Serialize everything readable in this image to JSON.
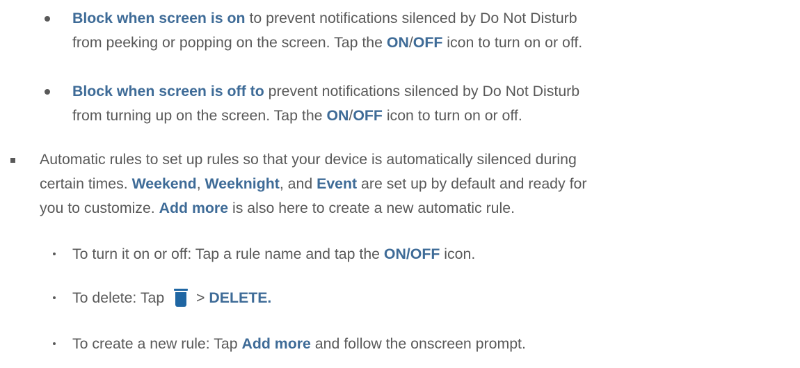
{
  "items": [
    {
      "b1": "Block when screen is on",
      "t1": " to prevent notifications silenced by Do Not Disturb",
      "t2": "from peeking or popping on the screen. Tap the ",
      "b2": "ON",
      "sep": "/",
      "b3": "OFF",
      "t3": " icon to turn on or off."
    },
    {
      "b1": "Block when screen is off to",
      "t1": " prevent notifications silenced by Do Not Disturb",
      "t2": "from turning up on the screen. Tap the ",
      "b2": "ON",
      "sep": "/",
      "b3": "OFF",
      "t3": " icon to turn on or off."
    },
    {
      "t1": "Automatic rules to set up rules so that your device is automatically silenced during",
      "t2": "certain times. ",
      "b1": "Weekend",
      "c1": ", ",
      "b2": "Weeknight",
      "c2": ", and ",
      "b3": "Event",
      "t3": " are set up by default and ready for",
      "t4": "you to customize. ",
      "b4": "Add more",
      "t5": " is also here to create a new automatic rule."
    },
    {
      "t1": "To turn it on or off: Tap a rule name and tap the ",
      "b1": "ON/OFF",
      "t2": " icon."
    },
    {
      "t1": "To delete: Tap ",
      "icon": "trash-icon",
      "t2": " > ",
      "b1": "DELETE."
    },
    {
      "t1": "To create a new rule: Tap ",
      "b1": "Add more",
      "t2": " and follow the onscreen prompt."
    }
  ],
  "colors": {
    "text": "#595959",
    "bold": "#3e6b97",
    "icon": "#1f66a3"
  }
}
